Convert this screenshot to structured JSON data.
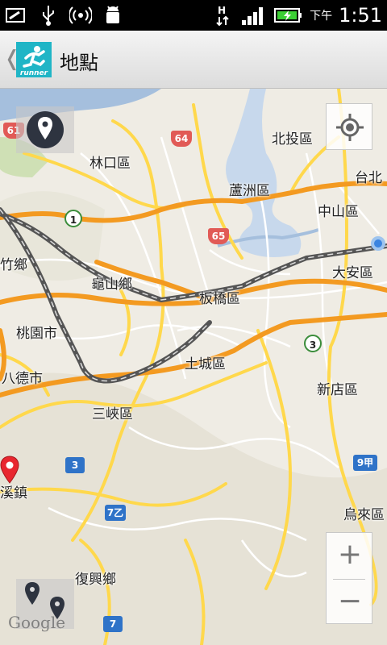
{
  "statusbar": {
    "ampm": "下午",
    "time": "1:51"
  },
  "actionbar": {
    "back_glyph": "❬",
    "title": "地點",
    "app_icon_text": "runner"
  },
  "map": {
    "labels": [
      {
        "name": "beitou",
        "text": "北投區"
      },
      {
        "name": "linkou",
        "text": "林口區"
      },
      {
        "name": "luzhou",
        "text": "蘆洲區"
      },
      {
        "name": "taipei",
        "text": "台北"
      },
      {
        "name": "zhongshan",
        "text": "中山區"
      },
      {
        "name": "zhu-xiang",
        "text": "竹鄉"
      },
      {
        "name": "guishan",
        "text": "龜山鄉"
      },
      {
        "name": "banqiao",
        "text": "板橋區"
      },
      {
        "name": "daan",
        "text": "大安區"
      },
      {
        "name": "taoyuan",
        "text": "桃園市"
      },
      {
        "name": "tucheng",
        "text": "土城區"
      },
      {
        "name": "bade",
        "text": "八德市"
      },
      {
        "name": "xindian",
        "text": "新店區"
      },
      {
        "name": "sanxia",
        "text": "三峽區"
      },
      {
        "name": "xi-town",
        "text": "溪鎮"
      },
      {
        "name": "wulai",
        "text": "烏來區"
      },
      {
        "name": "fuxing",
        "text": "復興鄉"
      }
    ],
    "shields": {
      "r61": "61",
      "r64": "64",
      "r65": "65",
      "r1": "1",
      "r3a": "3",
      "r3b": "3",
      "r7": "7",
      "r7b": "7乙",
      "r9": "9甲"
    },
    "zoom_in": "+",
    "zoom_out": "−",
    "logo": "Google"
  },
  "colors": {
    "map_bg": "#efece4",
    "water": "#a5bfdd",
    "highway": "#f39a21",
    "main_road": "#ffd84c",
    "rail": "#555555",
    "pin_red": "#e8262f",
    "pin_dark": "#2e3440"
  },
  "icons": {
    "statusbar_left": [
      "screen-icon",
      "usb-icon",
      "wifi-hotspot-icon",
      "android-debug-icon"
    ],
    "statusbar_right": [
      "data-transfer-icon",
      "signal-icon",
      "battery-charging-icon"
    ],
    "map_controls": [
      "location-pin-icon",
      "my-location-icon",
      "multi-pin-icon"
    ]
  }
}
